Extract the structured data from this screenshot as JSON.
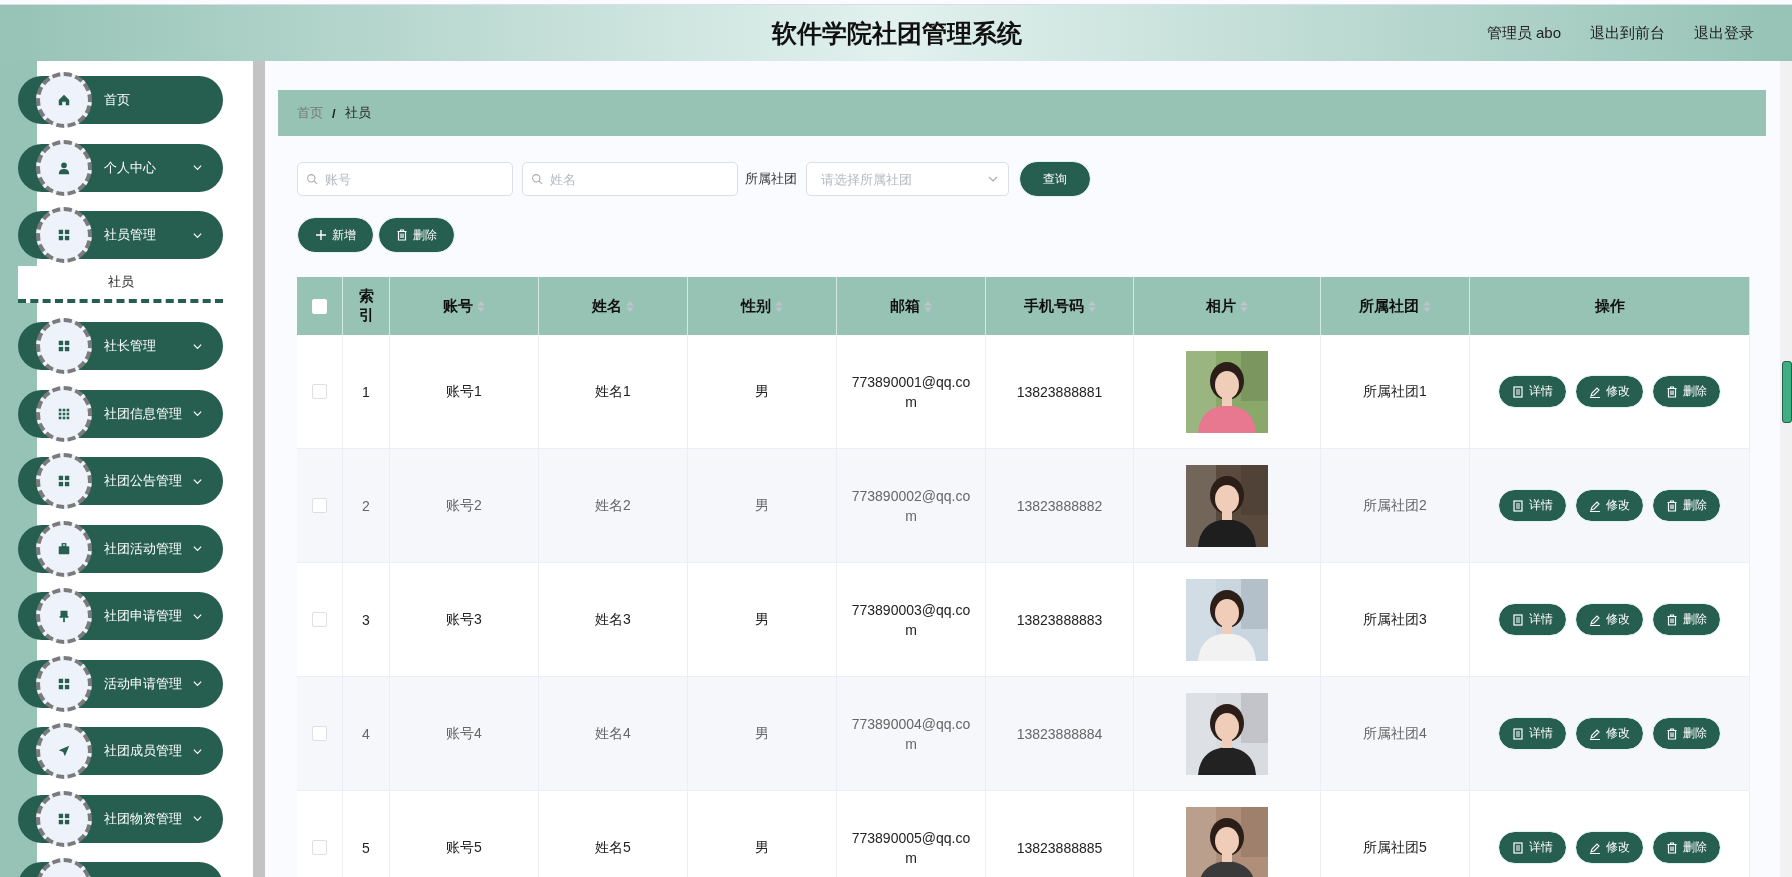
{
  "header": {
    "title": "软件学院社团管理系统",
    "links": [
      "管理员 abo",
      "退出到前台",
      "退出登录"
    ]
  },
  "sidebar": {
    "items": [
      {
        "label": "首页",
        "kind": "link"
      },
      {
        "label": "个人中心",
        "kind": "menu"
      },
      {
        "label": "社员管理",
        "kind": "menu",
        "children": [
          {
            "label": "社员",
            "selected": true
          }
        ]
      },
      {
        "label": "社长管理",
        "kind": "menu"
      },
      {
        "label": "社团信息管理",
        "kind": "menu"
      },
      {
        "label": "社团公告管理",
        "kind": "menu"
      },
      {
        "label": "社团活动管理",
        "kind": "menu"
      },
      {
        "label": "社团申请管理",
        "kind": "menu"
      },
      {
        "label": "活动申请管理",
        "kind": "menu"
      },
      {
        "label": "社团成员管理",
        "kind": "menu"
      },
      {
        "label": "社团物资管理",
        "kind": "menu"
      },
      {
        "kind": "cut"
      }
    ]
  },
  "breadcrumb": {
    "items": [
      "首页",
      "社员"
    ],
    "separator": "/"
  },
  "filters": {
    "account": {
      "placeholder": "账号"
    },
    "name": {
      "placeholder": "姓名"
    },
    "club": {
      "label": "所属社团",
      "placeholder": "请选择所属社团"
    },
    "search_button": "查询"
  },
  "toolbar": [
    "新增",
    "删除"
  ],
  "table": {
    "all_checked": false,
    "columns": [
      {
        "label": "索引",
        "sortable": false
      },
      {
        "label": "账号",
        "sortable": true
      },
      {
        "label": "姓名",
        "sortable": true
      },
      {
        "label": "性别",
        "sortable": true
      },
      {
        "label": "邮箱",
        "sortable": true
      },
      {
        "label": "手机号码",
        "sortable": true
      },
      {
        "label": "相片",
        "sortable": true
      },
      {
        "label": "所属社团",
        "sortable": true
      },
      {
        "label": "操作",
        "sortable": false
      }
    ],
    "rows": [
      {
        "checked": false,
        "index": "1",
        "account": "账号1",
        "name": "姓名1",
        "gender": "男",
        "email": "773890001@qq.com",
        "phone": "13823888881",
        "club": "所属社团1",
        "actions": [
          "详情",
          "修改",
          "删除"
        ]
      },
      {
        "checked": false,
        "index": "2",
        "account": "账号2",
        "name": "姓名2",
        "gender": "男",
        "email": "773890002@qq.com",
        "phone": "13823888882",
        "club": "所属社团2",
        "actions": [
          "详情",
          "修改",
          "删除"
        ]
      },
      {
        "checked": false,
        "index": "3",
        "account": "账号3",
        "name": "姓名3",
        "gender": "男",
        "email": "773890003@qq.com",
        "phone": "13823888883",
        "club": "所属社团3",
        "actions": [
          "详情",
          "修改",
          "删除"
        ]
      },
      {
        "checked": false,
        "index": "4",
        "account": "账号4",
        "name": "姓名4",
        "gender": "男",
        "email": "773890004@qq.com",
        "phone": "13823888884",
        "club": "所属社团4",
        "actions": [
          "详情",
          "修改",
          "删除"
        ]
      },
      {
        "checked": false,
        "index": "5",
        "account": "账号5",
        "name": "姓名5",
        "gender": "男",
        "email": "773890005@qq.com",
        "phone": "13823888885",
        "club": "所属社团5",
        "actions": [
          "详情",
          "修改",
          "删除"
        ]
      }
    ]
  }
}
